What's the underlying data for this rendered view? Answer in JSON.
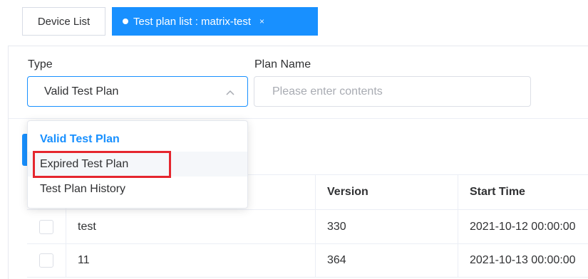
{
  "tabs": [
    {
      "label": "Device List"
    },
    {
      "label": "Test plan list : matrix-test",
      "close": "×"
    }
  ],
  "filters": {
    "type_label": "Type",
    "type_value": "Valid Test Plan",
    "plan_name_label": "Plan Name",
    "plan_name_placeholder": "Please enter contents"
  },
  "dropdown": {
    "options": [
      {
        "label": "Valid Test Plan",
        "state": "selected"
      },
      {
        "label": "Expired Test Plan",
        "state": "hover"
      },
      {
        "label": "Test Plan History",
        "state": "normal"
      }
    ]
  },
  "table": {
    "headers": {
      "version": "Version",
      "start_time": "Start Time"
    },
    "rows": [
      {
        "name": "test",
        "version": "330",
        "start_time": "2021-10-12 00:00:00"
      },
      {
        "name": "11",
        "version": "364",
        "start_time": "2021-10-13 00:00:00"
      }
    ]
  },
  "colors": {
    "accent": "#1890ff",
    "highlight": "#e5262e"
  },
  "icons": {
    "tab_dot": "dot-icon",
    "tab_close": "close-icon",
    "select_arrow": "chevron-up-icon"
  }
}
